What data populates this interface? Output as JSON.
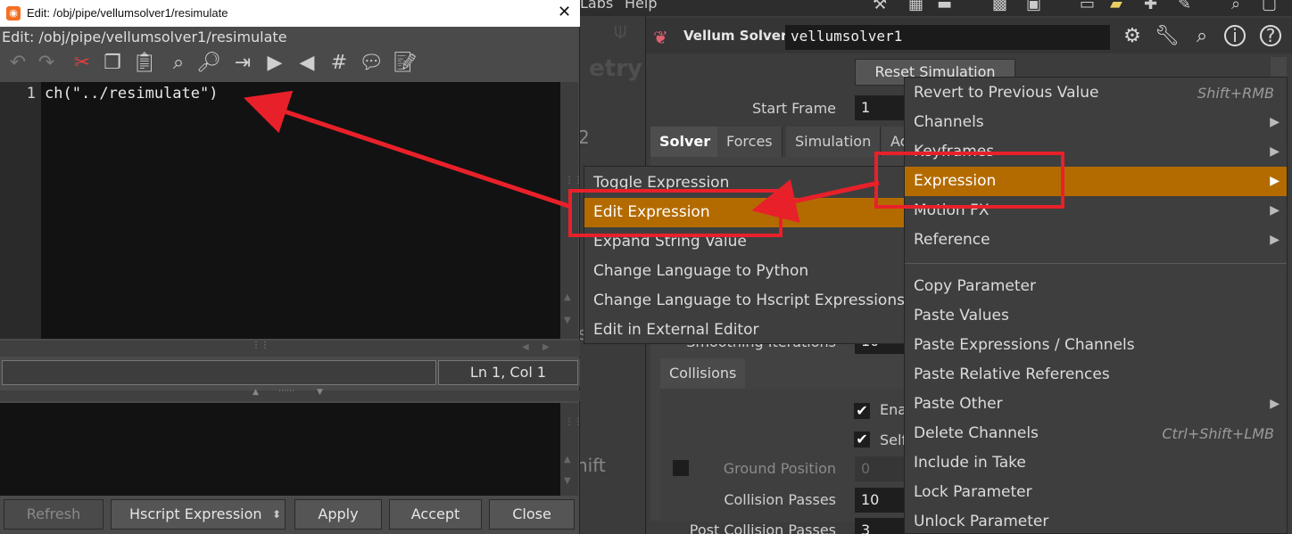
{
  "edit_window": {
    "title": "Edit: /obj/pipe/vellumsolver1/resimulate",
    "subtitle": "Edit: /obj/pipe/vellumsolver1/resimulate",
    "line_number": "1",
    "code": "ch(\"../resimulate\")",
    "cursor_position": "Ln 1, Col 1",
    "buttons": {
      "refresh": "Refresh",
      "language": "Hscript Expression",
      "apply": "Apply",
      "accept": "Accept",
      "close": "Close"
    }
  },
  "background": {
    "menu_labs": "Labs",
    "menu_help": "Help",
    "net_text_1": "etry",
    "net_text_2": "2",
    "net_text_3": "s",
    "net_text_4": "hift"
  },
  "parameters": {
    "node_type": "Vellum Solver",
    "node_name": "vellumsolver1",
    "reset_button": "Reset Simulation",
    "start_frame_label": "Start Frame",
    "start_frame_value": "1",
    "tabs": [
      "Solver",
      "Forces",
      "Simulation",
      "Ac"
    ],
    "smoothing_label": "Smoothing Iterations",
    "smoothing_value": "10",
    "collisions_tab": "Collisions",
    "enable_label": "Ena",
    "self_label": "Self",
    "ground_position_label": "Ground Position",
    "ground_position_value": "0",
    "collision_passes_label": "Collision Passes",
    "collision_passes_value": "10",
    "post_collision_label": "Post Collision Passes",
    "post_collision_value": "3"
  },
  "submenu": {
    "items": [
      "Toggle Expression",
      "Edit Expression",
      "Expand String Value",
      "Change Language to Python",
      "Change Language to Hscript Expressions",
      "Edit in External Editor"
    ],
    "highlighted": "Edit Expression"
  },
  "context_menu": {
    "items": [
      {
        "label": "Revert to Previous Value",
        "shortcut": "Shift+RMB"
      },
      {
        "label": "Channels",
        "submenu": true
      },
      {
        "label": "Keyframes",
        "submenu": true
      },
      {
        "label": "Expression",
        "submenu": true
      },
      {
        "label": "Motion FX",
        "submenu": true
      },
      {
        "label": "Reference",
        "submenu": true
      },
      {
        "label": "Copy Parameter"
      },
      {
        "label": "Paste Values"
      },
      {
        "label": "Paste Expressions / Channels"
      },
      {
        "label": "Paste Relative References"
      },
      {
        "label": "Paste Other",
        "submenu": true
      },
      {
        "label": "Delete Channels",
        "shortcut": "Ctrl+Shift+LMB"
      },
      {
        "label": "Include in Take"
      },
      {
        "label": "Lock Parameter"
      },
      {
        "label": "Unlock Parameter"
      }
    ],
    "highlighted": "Expression"
  },
  "colors": {
    "highlight": "#b36b00",
    "annotation": "#e8202a"
  }
}
